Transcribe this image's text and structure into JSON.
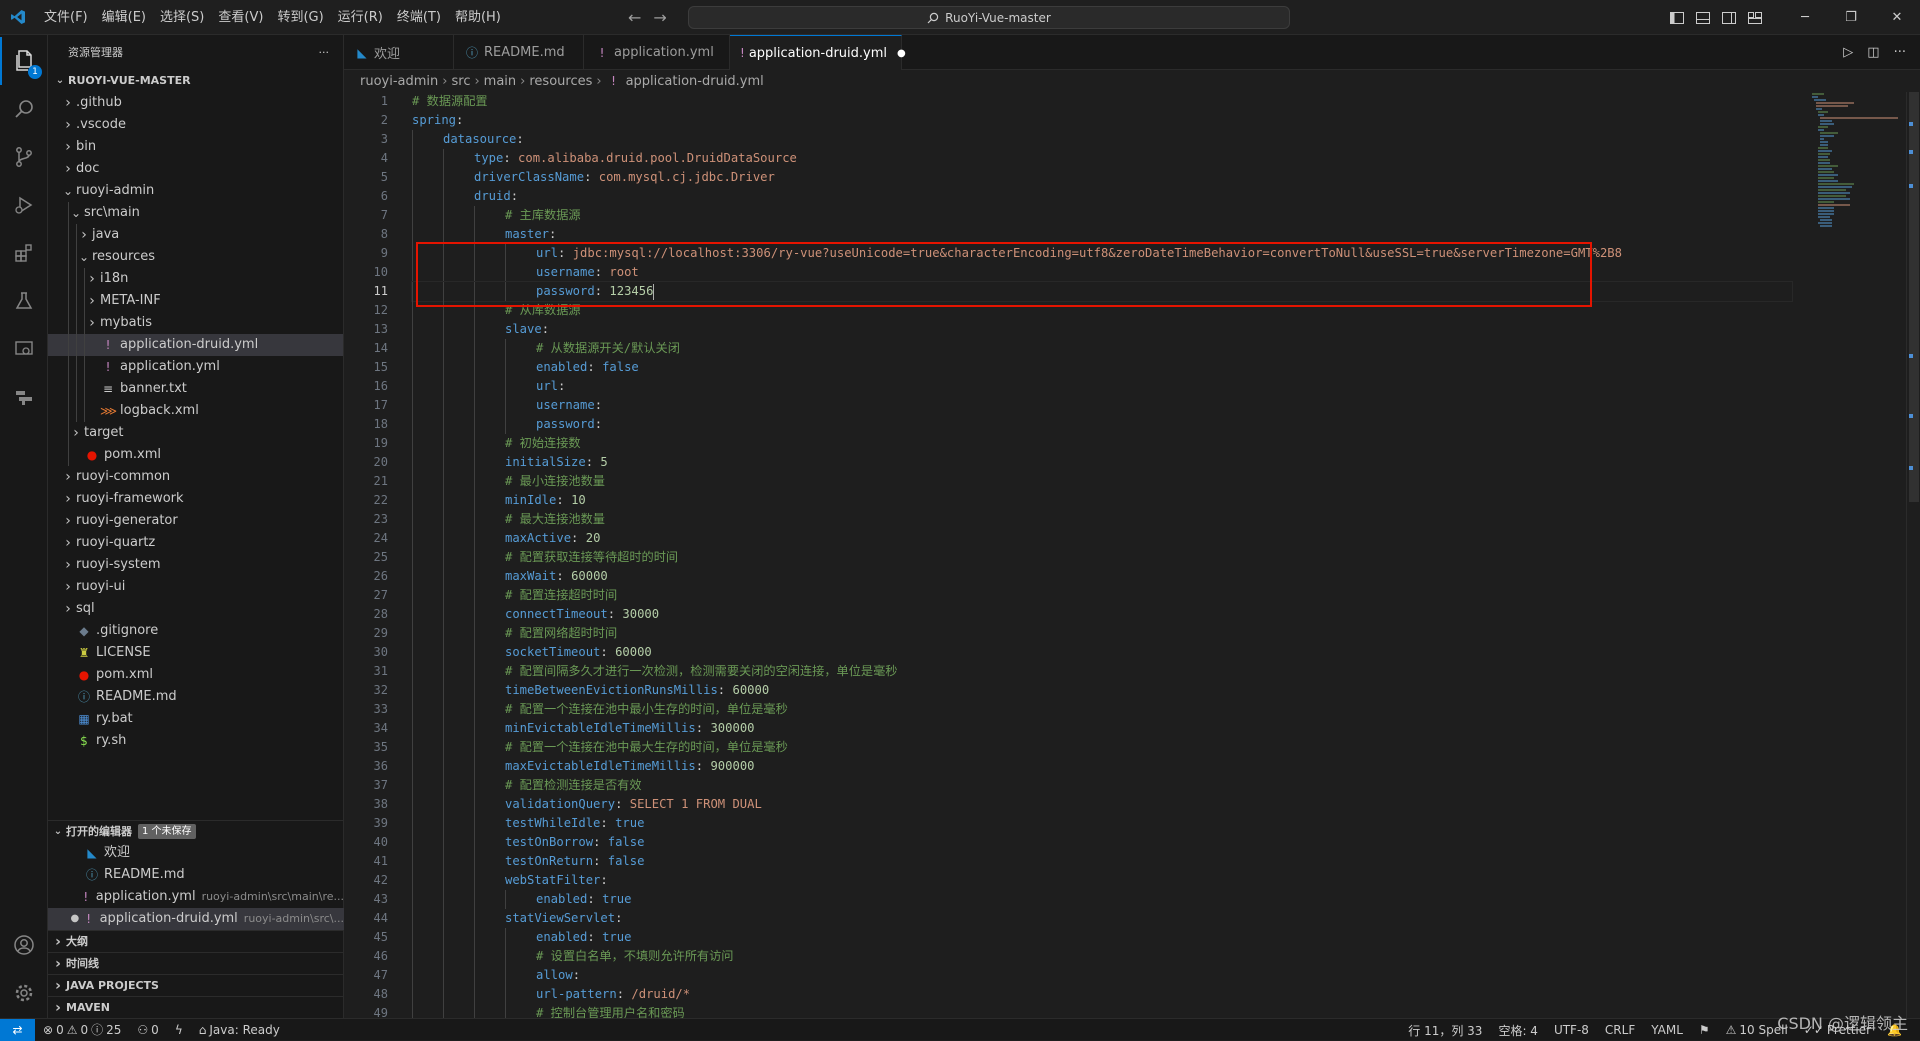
{
  "menu": [
    "文件(F)",
    "编辑(E)",
    "选择(S)",
    "查看(V)",
    "转到(G)",
    "运行(R)",
    "终端(T)",
    "帮助(H)"
  ],
  "search": {
    "text": "RuoYi-Vue-master"
  },
  "colors": {
    "accent": "#0078d4",
    "highlight_box": "#e51400",
    "keyword": "#569cd6",
    "string": "#ce9178",
    "comment": "#6a9955"
  },
  "activity_bar": {
    "explorer_badge": "1"
  },
  "explorer": {
    "title": "资源管理器",
    "more": "···",
    "root": "RUOYI-VUE-MASTER",
    "items": [
      {
        "label": ".github",
        "type": "folder",
        "depth": 1,
        "open": false
      },
      {
        "label": ".vscode",
        "type": "folder",
        "depth": 1,
        "open": false
      },
      {
        "label": "bin",
        "type": "folder",
        "depth": 1,
        "open": false
      },
      {
        "label": "doc",
        "type": "folder",
        "depth": 1,
        "open": false
      },
      {
        "label": "ruoyi-admin",
        "type": "folder",
        "depth": 1,
        "open": true
      },
      {
        "label": "src\\main",
        "type": "folder",
        "depth": 2,
        "open": true
      },
      {
        "label": "java",
        "type": "folder",
        "depth": 3,
        "open": false
      },
      {
        "label": "resources",
        "type": "folder",
        "depth": 3,
        "open": true
      },
      {
        "label": "i18n",
        "type": "folder",
        "depth": 4,
        "open": false
      },
      {
        "label": "META-INF",
        "type": "folder",
        "depth": 4,
        "open": false
      },
      {
        "label": "mybatis",
        "type": "folder",
        "depth": 4,
        "open": false
      },
      {
        "label": "application-druid.yml",
        "type": "yml",
        "depth": 4,
        "selected": true
      },
      {
        "label": "application.yml",
        "type": "yml",
        "depth": 4
      },
      {
        "label": "banner.txt",
        "type": "txt",
        "depth": 4
      },
      {
        "label": "logback.xml",
        "type": "xml",
        "depth": 4
      },
      {
        "label": "target",
        "type": "folder",
        "depth": 2,
        "open": false
      },
      {
        "label": "pom.xml",
        "type": "pom",
        "depth": 2
      },
      {
        "label": "ruoyi-common",
        "type": "folder",
        "depth": 1,
        "open": false
      },
      {
        "label": "ruoyi-framework",
        "type": "folder",
        "depth": 1,
        "open": false
      },
      {
        "label": "ruoyi-generator",
        "type": "folder",
        "depth": 1,
        "open": false
      },
      {
        "label": "ruoyi-quartz",
        "type": "folder",
        "depth": 1,
        "open": false
      },
      {
        "label": "ruoyi-system",
        "type": "folder",
        "depth": 1,
        "open": false
      },
      {
        "label": "ruoyi-ui",
        "type": "folder",
        "depth": 1,
        "open": false
      },
      {
        "label": "sql",
        "type": "folder",
        "depth": 1,
        "open": false
      },
      {
        "label": ".gitignore",
        "type": "git",
        "depth": 1
      },
      {
        "label": "LICENSE",
        "type": "license",
        "depth": 1
      },
      {
        "label": "pom.xml",
        "type": "pom",
        "depth": 1
      },
      {
        "label": "README.md",
        "type": "info",
        "depth": 1
      },
      {
        "label": "ry.bat",
        "type": "bat",
        "depth": 1
      },
      {
        "label": "ry.sh",
        "type": "sh",
        "depth": 1
      }
    ]
  },
  "open_editors": {
    "title": "打开的编辑器",
    "unsaved_badge": "1 个未保存",
    "items": [
      {
        "label": "欢迎",
        "type": "vscode",
        "path": ""
      },
      {
        "label": "README.md",
        "type": "info",
        "path": ""
      },
      {
        "label": "application.yml",
        "type": "yml",
        "path": "ruoyi-admin\\src\\main\\re..."
      },
      {
        "label": "application-druid.yml",
        "type": "yml",
        "path": "ruoyi-admin\\src\\...",
        "dirty": true
      }
    ]
  },
  "bottom_sections": [
    "大纲",
    "时间线",
    "JAVA PROJECTS",
    "MAVEN"
  ],
  "tabs": [
    {
      "label": "欢迎",
      "type": "vscode",
      "active": false
    },
    {
      "label": "README.md",
      "type": "info",
      "active": false
    },
    {
      "label": "application.yml",
      "type": "yml",
      "active": false
    },
    {
      "label": "application-druid.yml",
      "type": "yml",
      "active": true,
      "dirty": true
    }
  ],
  "breadcrumb": [
    "ruoyi-admin",
    "src",
    "main",
    "resources",
    "application-druid.yml"
  ],
  "editor": {
    "current_line": 11,
    "lines": [
      [
        [
          "c",
          "# 数据源配置"
        ]
      ],
      [
        [
          "k",
          "spring"
        ],
        [
          "p",
          ":"
        ]
      ],
      [
        [
          "i",
          1
        ],
        [
          "k",
          "datasource"
        ],
        [
          "p",
          ":"
        ]
      ],
      [
        [
          "i",
          2
        ],
        [
          "k",
          "type"
        ],
        [
          "p",
          ": "
        ],
        [
          "s",
          "com.alibaba.druid.pool.DruidDataSource"
        ]
      ],
      [
        [
          "i",
          2
        ],
        [
          "k",
          "driverClassName"
        ],
        [
          "p",
          ": "
        ],
        [
          "s",
          "com.mysql.cj.jdbc.Driver"
        ]
      ],
      [
        [
          "i",
          2
        ],
        [
          "k",
          "druid"
        ],
        [
          "p",
          ":"
        ]
      ],
      [
        [
          "i",
          3
        ],
        [
          "c",
          "# 主库数据源"
        ]
      ],
      [
        [
          "i",
          3
        ],
        [
          "k",
          "master"
        ],
        [
          "p",
          ":"
        ]
      ],
      [
        [
          "i",
          4
        ],
        [
          "k",
          "url"
        ],
        [
          "p",
          ": "
        ],
        [
          "s",
          "jdbc:mysql://localhost:3306/ry-vue?useUnicode=true&characterEncoding=utf8&zeroDateTimeBehavior=convertToNull&useSSL=true&serverTimezone=GMT%2B8"
        ]
      ],
      [
        [
          "i",
          4
        ],
        [
          "k",
          "username"
        ],
        [
          "p",
          ": "
        ],
        [
          "s",
          "root"
        ]
      ],
      [
        [
          "i",
          4
        ],
        [
          "k",
          "password"
        ],
        [
          "p",
          ": "
        ],
        [
          "n",
          "123456"
        ]
      ],
      [
        [
          "i",
          3
        ],
        [
          "c",
          "# 从库数据源"
        ]
      ],
      [
        [
          "i",
          3
        ],
        [
          "k",
          "slave"
        ],
        [
          "p",
          ":"
        ]
      ],
      [
        [
          "i",
          4
        ],
        [
          "c",
          "# 从数据源开关/默认关闭"
        ]
      ],
      [
        [
          "i",
          4
        ],
        [
          "k",
          "enabled"
        ],
        [
          "p",
          ": "
        ],
        [
          "k",
          "false"
        ]
      ],
      [
        [
          "i",
          4
        ],
        [
          "k",
          "url"
        ],
        [
          "p",
          ":"
        ]
      ],
      [
        [
          "i",
          4
        ],
        [
          "k",
          "username"
        ],
        [
          "p",
          ":"
        ]
      ],
      [
        [
          "i",
          4
        ],
        [
          "k",
          "password"
        ],
        [
          "p",
          ":"
        ]
      ],
      [
        [
          "i",
          3
        ],
        [
          "c",
          "# 初始连接数"
        ]
      ],
      [
        [
          "i",
          3
        ],
        [
          "k",
          "initialSize"
        ],
        [
          "p",
          ": "
        ],
        [
          "n",
          "5"
        ]
      ],
      [
        [
          "i",
          3
        ],
        [
          "c",
          "# 最小连接池数量"
        ]
      ],
      [
        [
          "i",
          3
        ],
        [
          "k",
          "minIdle"
        ],
        [
          "p",
          ": "
        ],
        [
          "n",
          "10"
        ]
      ],
      [
        [
          "i",
          3
        ],
        [
          "c",
          "# 最大连接池数量"
        ]
      ],
      [
        [
          "i",
          3
        ],
        [
          "k",
          "maxActive"
        ],
        [
          "p",
          ": "
        ],
        [
          "n",
          "20"
        ]
      ],
      [
        [
          "i",
          3
        ],
        [
          "c",
          "# 配置获取连接等待超时的时间"
        ]
      ],
      [
        [
          "i",
          3
        ],
        [
          "k",
          "maxWait"
        ],
        [
          "p",
          ": "
        ],
        [
          "n",
          "60000"
        ]
      ],
      [
        [
          "i",
          3
        ],
        [
          "c",
          "# 配置连接超时时间"
        ]
      ],
      [
        [
          "i",
          3
        ],
        [
          "k",
          "connectTimeout"
        ],
        [
          "p",
          ": "
        ],
        [
          "n",
          "30000"
        ]
      ],
      [
        [
          "i",
          3
        ],
        [
          "c",
          "# 配置网络超时时间"
        ]
      ],
      [
        [
          "i",
          3
        ],
        [
          "k",
          "socketTimeout"
        ],
        [
          "p",
          ": "
        ],
        [
          "n",
          "60000"
        ]
      ],
      [
        [
          "i",
          3
        ],
        [
          "c",
          "# 配置间隔多久才进行一次检测，检测需要关闭的空闲连接，单位是毫秒"
        ]
      ],
      [
        [
          "i",
          3
        ],
        [
          "k",
          "timeBetweenEvictionRunsMillis"
        ],
        [
          "p",
          ": "
        ],
        [
          "n",
          "60000"
        ]
      ],
      [
        [
          "i",
          3
        ],
        [
          "c",
          "# 配置一个连接在池中最小生存的时间，单位是毫秒"
        ]
      ],
      [
        [
          "i",
          3
        ],
        [
          "k",
          "minEvictableIdleTimeMillis"
        ],
        [
          "p",
          ": "
        ],
        [
          "n",
          "300000"
        ]
      ],
      [
        [
          "i",
          3
        ],
        [
          "c",
          "# 配置一个连接在池中最大生存的时间，单位是毫秒"
        ]
      ],
      [
        [
          "i",
          3
        ],
        [
          "k",
          "maxEvictableIdleTimeMillis"
        ],
        [
          "p",
          ": "
        ],
        [
          "n",
          "900000"
        ]
      ],
      [
        [
          "i",
          3
        ],
        [
          "c",
          "# 配置检测连接是否有效"
        ]
      ],
      [
        [
          "i",
          3
        ],
        [
          "k",
          "validationQuery"
        ],
        [
          "p",
          ": "
        ],
        [
          "s",
          "SELECT 1 FROM DUAL"
        ]
      ],
      [
        [
          "i",
          3
        ],
        [
          "k",
          "testWhileIdle"
        ],
        [
          "p",
          ": "
        ],
        [
          "k",
          "true"
        ]
      ],
      [
        [
          "i",
          3
        ],
        [
          "k",
          "testOnBorrow"
        ],
        [
          "p",
          ": "
        ],
        [
          "k",
          "false"
        ]
      ],
      [
        [
          "i",
          3
        ],
        [
          "k",
          "testOnReturn"
        ],
        [
          "p",
          ": "
        ],
        [
          "k",
          "false"
        ]
      ],
      [
        [
          "i",
          3
        ],
        [
          "k",
          "webStatFilter"
        ],
        [
          "p",
          ":"
        ]
      ],
      [
        [
          "i",
          4
        ],
        [
          "k",
          "enabled"
        ],
        [
          "p",
          ": "
        ],
        [
          "k",
          "true"
        ]
      ],
      [
        [
          "i",
          3
        ],
        [
          "k",
          "statViewServlet"
        ],
        [
          "p",
          ":"
        ]
      ],
      [
        [
          "i",
          4
        ],
        [
          "k",
          "enabled"
        ],
        [
          "p",
          ": "
        ],
        [
          "k",
          "true"
        ]
      ],
      [
        [
          "i",
          4
        ],
        [
          "c",
          "# 设置白名单，不填则允许所有访问"
        ]
      ],
      [
        [
          "i",
          4
        ],
        [
          "k",
          "allow"
        ],
        [
          "p",
          ":"
        ]
      ],
      [
        [
          "i",
          4
        ],
        [
          "k",
          "url-pattern"
        ],
        [
          "p",
          ": "
        ],
        [
          "s",
          "/druid/*"
        ]
      ],
      [
        [
          "i",
          4
        ],
        [
          "c",
          "# 控制台管理用户名和密码"
        ]
      ]
    ]
  },
  "status": {
    "errors": "0",
    "warnings": "0",
    "infos": "25",
    "ports": "0",
    "java": "Java: Ready",
    "position": "行 11，列 33",
    "spaces": "空格: 4",
    "encoding": "UTF-8",
    "eol": "CRLF",
    "language": "YAML",
    "spell": "10 Spell",
    "prettier": "Prettier"
  },
  "watermark": "CSDN @逻辑领主"
}
